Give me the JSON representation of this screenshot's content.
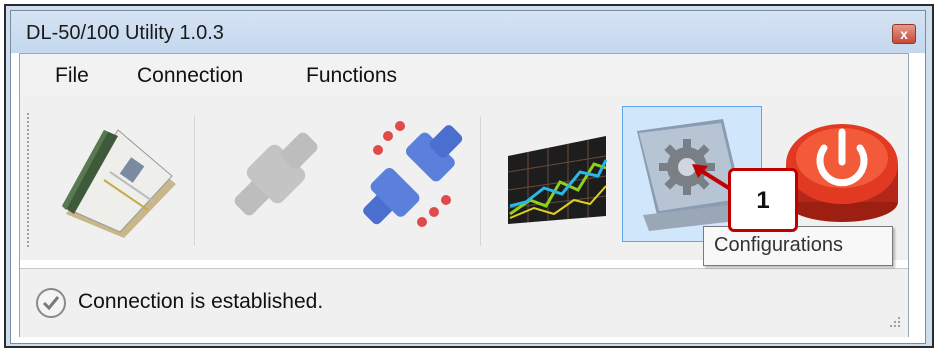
{
  "window": {
    "title": "DL-50/100 Utility 1.0.3",
    "close_glyph": "x"
  },
  "menu": [
    {
      "label": "File"
    },
    {
      "label": "Connection"
    },
    {
      "label": "Functions"
    }
  ],
  "toolbar": {
    "tools": [
      {
        "icon": "passport-document-icon"
      },
      {
        "icon": "connect-plug-icon",
        "state": "disabled"
      },
      {
        "icon": "disconnect-plug-icon"
      },
      {
        "icon": "realtime-chart-icon"
      },
      {
        "icon": "configurations-gear-icon",
        "state": "selected"
      },
      {
        "icon": "power-exit-icon"
      }
    ]
  },
  "tooltip": {
    "text": "Configurations"
  },
  "annotation": {
    "number": "1",
    "color": "#c00000"
  },
  "status": {
    "icon": "check-circle-icon",
    "text": "Connection is established."
  }
}
